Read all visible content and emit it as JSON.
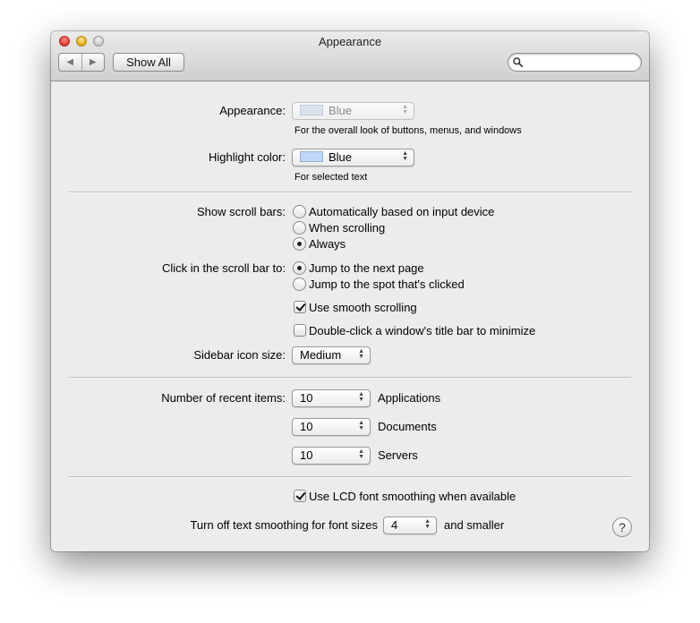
{
  "window": {
    "title": "Appearance"
  },
  "toolbar": {
    "back_icon": "◀",
    "forward_icon": "▶",
    "show_all": "Show All",
    "search_placeholder": ""
  },
  "appearance": {
    "label": "Appearance:",
    "value": "Blue",
    "note": "For the overall look of buttons, menus, and windows"
  },
  "highlight": {
    "label": "Highlight color:",
    "value": "Blue",
    "note": "For selected text",
    "swatch_color": "#bdd6fa"
  },
  "scroll_bars": {
    "label": "Show scroll bars:",
    "options": [
      "Automatically based on input device",
      "When scrolling",
      "Always"
    ],
    "selected": "Always"
  },
  "click_scroll": {
    "label": "Click in the scroll bar to:",
    "options": [
      "Jump to the next page",
      "Jump to the spot that's clicked"
    ],
    "selected": "Jump to the next page"
  },
  "checkboxes": {
    "smooth_scrolling": "Use smooth scrolling",
    "smooth_scrolling_checked": true,
    "double_click": "Double-click a window's title bar to minimize",
    "double_click_checked": false
  },
  "sidebar": {
    "label": "Sidebar icon size:",
    "value": "Medium"
  },
  "recent": {
    "label": "Number of recent items:",
    "rows": [
      {
        "value": "10",
        "kind": "Applications"
      },
      {
        "value": "10",
        "kind": "Documents"
      },
      {
        "value": "10",
        "kind": "Servers"
      }
    ]
  },
  "lcd": {
    "label": "Use LCD font smoothing when available",
    "checked": true
  },
  "text_smoothing": {
    "prefix": "Turn off text smoothing for font sizes",
    "value": "4",
    "suffix": "and smaller"
  },
  "help": "?",
  "colors": {
    "accent": "#3875d7",
    "window_bg": "#ececec"
  }
}
